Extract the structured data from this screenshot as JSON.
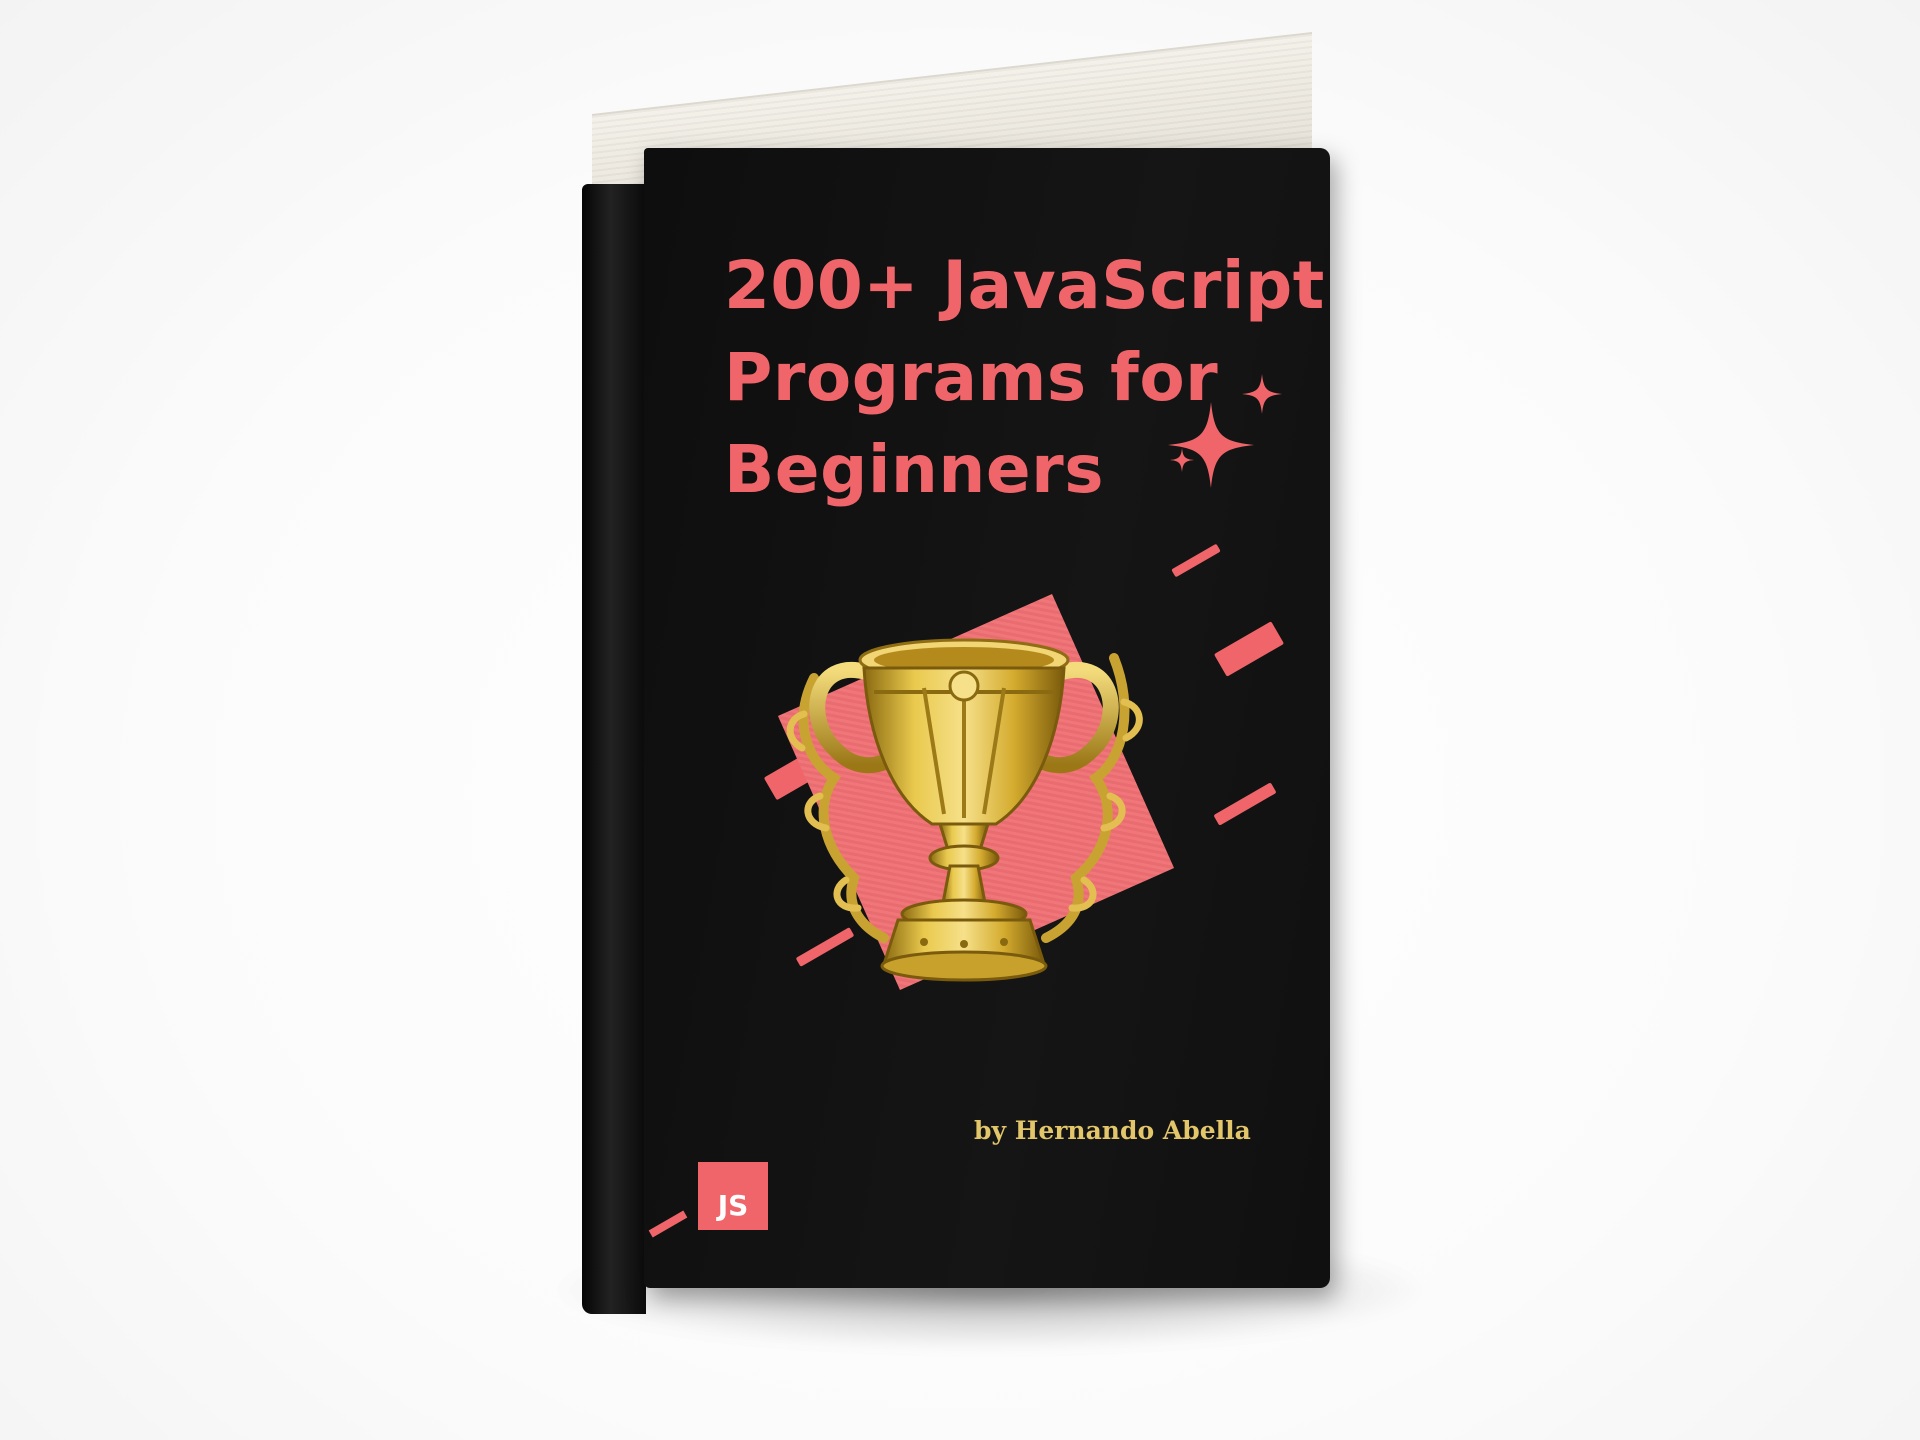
{
  "book": {
    "title_lines": [
      "200+ JavaScript",
      "Programs for",
      "Beginners"
    ],
    "author": "by Hernando Abella",
    "badge": "JS",
    "illustration": "trophy-icon",
    "colors": {
      "accent": "#f0656a",
      "cover": "#141414",
      "gold": "#e3c56a",
      "background": "#ffffff"
    }
  }
}
